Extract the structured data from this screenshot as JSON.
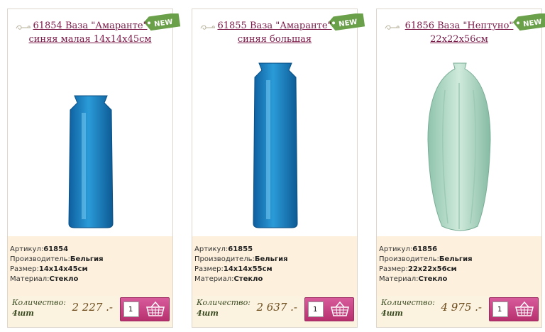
{
  "products": [
    {
      "title": "61854 Ваза \"Амаранте\" синяя малая 14х14х45см",
      "badge": "NEW",
      "article_label": "Артикул:",
      "article": "61854",
      "maker_label": "Производитель:",
      "maker": "Бельгия",
      "size_label": "Размер:",
      "size": "14х14х45см",
      "material_label": "Материал:",
      "material": "Стекло",
      "qty_label": "Количество:",
      "qty_unit": "4шт",
      "price": "2 227 .-",
      "qty_value": "1",
      "vase_color": "#1f7fc4"
    },
    {
      "title": "61855 Ваза \"Амаранте\" синяя большая",
      "badge": "NEW",
      "article_label": "Артикул:",
      "article": "61855",
      "maker_label": "Производитель:",
      "maker": "Бельгия",
      "size_label": "Размер:",
      "size": "14х14х55см",
      "material_label": "Материал:",
      "material": "Стекло",
      "qty_label": "Количество:",
      "qty_unit": "4шт",
      "price": "2 637 .-",
      "qty_value": "1",
      "vase_color": "#1f7fc4"
    },
    {
      "title": "61856 Ваза \"Нептуно\" 22х22х56см",
      "badge": "NEW",
      "article_label": "Артикул:",
      "article": "61856",
      "maker_label": "Производитель:",
      "maker": "Бельгия",
      "size_label": "Размер:",
      "size": "22х22х56см",
      "material_label": "Материал:",
      "material": "Стекло",
      "qty_label": "Количество:",
      "qty_unit": "4шт",
      "price": "4 975 .-",
      "qty_value": "1",
      "vase_color": "#a9d6c0"
    }
  ],
  "colors": {
    "title_link": "#7a1a48",
    "new_badge": "#6aa04a",
    "cart_button": "#c8417f",
    "info_bg": "#fdf1dd"
  }
}
